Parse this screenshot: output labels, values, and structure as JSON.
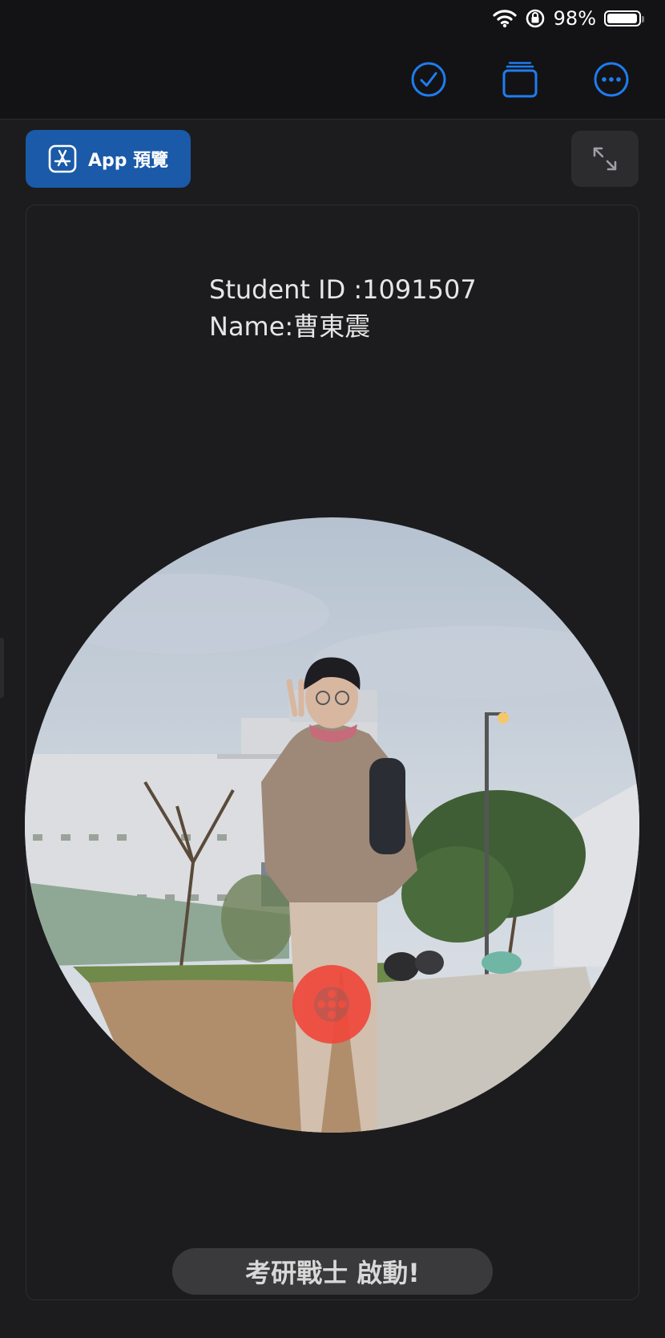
{
  "status_bar": {
    "battery_percent": "98%",
    "battery_level": 0.98,
    "icons": [
      "wifi-icon",
      "orientation-lock-icon",
      "battery-icon"
    ]
  },
  "toolbar": {
    "icons": [
      "checkmark-circle-icon",
      "stack-icon",
      "more-circle-icon"
    ],
    "accent": "#1f7cf0"
  },
  "preview_button": {
    "label": "App 預覽",
    "icon": "app-store-icon"
  },
  "expand_button": {
    "icon": "expand-arrows-icon"
  },
  "content": {
    "student_id": "Student ID :1091507",
    "name": "Name:曹東震"
  },
  "action_pill": {
    "label": "考研戰士 啟動!"
  },
  "colors": {
    "background": "#1c1c1e",
    "record": "#f0483c",
    "preview": "#1a5aa8"
  }
}
